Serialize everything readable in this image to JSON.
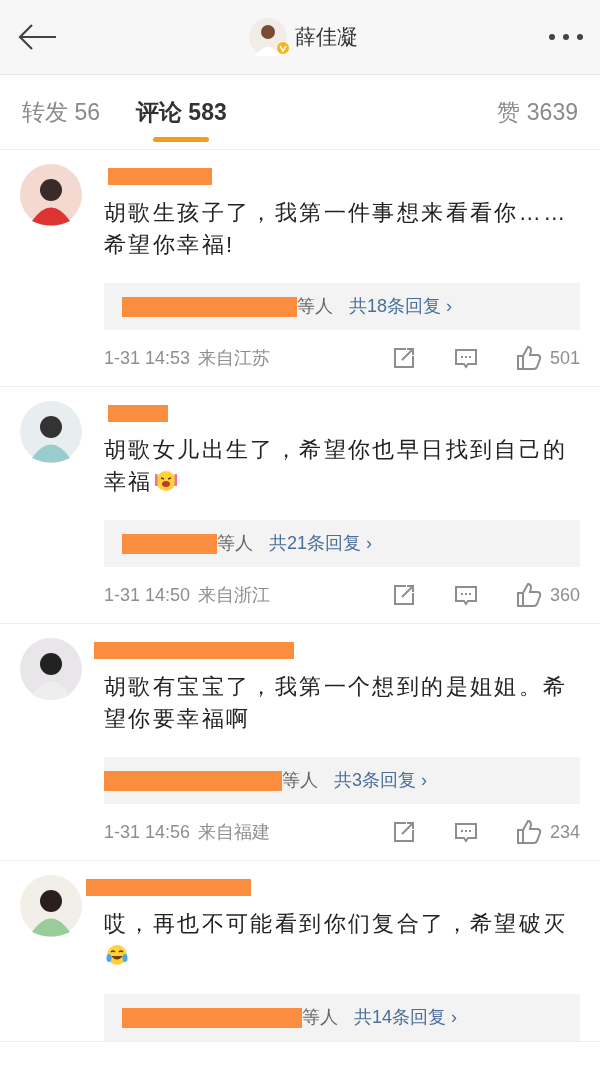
{
  "header": {
    "title": "薛佳凝",
    "verified": true
  },
  "tabs": [
    {
      "label": "转发 56",
      "selected": false
    },
    {
      "label": "评论 583",
      "selected": true
    },
    {
      "label": "赞 3639",
      "selected": false
    }
  ],
  "comments": [
    {
      "text": "胡歌生孩子了，我第一件事想来看看你……希望你幸福!",
      "replies_suffix": "等人",
      "replies_link": "共18条回复 ›",
      "time": "1-31 14:53",
      "location": "来自江苏",
      "likes": "501"
    },
    {
      "text": "胡歌女儿出生了，希望你也早日找到自己的幸福",
      "emoji": true,
      "replies_suffix": "等人",
      "replies_link": "共21条回复 ›",
      "time": "1-31 14:50",
      "location": "来自浙江",
      "likes": "360"
    },
    {
      "text": "胡歌有宝宝了，我第一个想到的是姐姐。希望你要幸福啊",
      "replies_suffix": "等人",
      "replies_link": "共3条回复 ›",
      "time": "1-31 14:56",
      "location": "来自福建",
      "likes": "234"
    },
    {
      "text": "哎，再也不可能看到你们复合了，希望破灭",
      "emoji": true,
      "replies_suffix": "等人",
      "replies_link": "共14条回复 ›"
    }
  ]
}
